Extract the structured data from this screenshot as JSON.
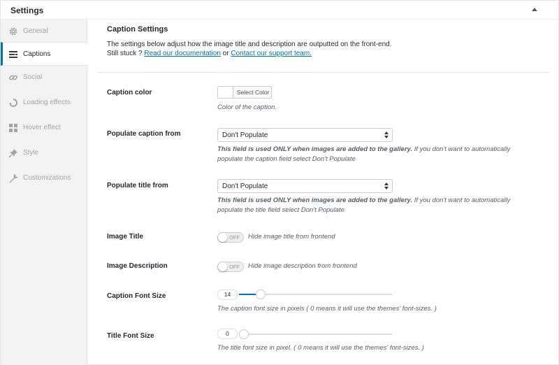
{
  "panel": {
    "title": "Settings"
  },
  "sidebar": {
    "items": [
      {
        "label": "General",
        "icon": "gear-icon",
        "active": false
      },
      {
        "label": "Captions",
        "icon": "caption-lines-icon",
        "active": true
      },
      {
        "label": "Social",
        "icon": "link-icon",
        "active": false
      },
      {
        "label": "Loading effects",
        "icon": "spinner-icon",
        "active": false
      },
      {
        "label": "Hover effect",
        "icon": "grid-icon",
        "active": false
      },
      {
        "label": "Style",
        "icon": "pin-icon",
        "active": false
      },
      {
        "label": "Customizations",
        "icon": "wrench-icon",
        "active": false
      }
    ]
  },
  "section": {
    "title": "Caption Settings",
    "desc_line1": "The settings below adjust how the image title and description are outputted on the front-end.",
    "desc_line2_prefix": "Still stuck ? ",
    "doc_link": "Read our documentation",
    "desc_or": " or ",
    "support_link": "Contact our support team."
  },
  "fields": {
    "caption_color": {
      "label": "Caption color",
      "button": "Select Color",
      "value": "#ffffff",
      "help": "Color of the caption."
    },
    "populate_caption": {
      "label": "Populate caption from",
      "value": "Don't Populate",
      "help_bold": "This field is used ONLY when images are added to the gallery.",
      "help_rest": " If you don't want to automatically populate the caption field select Don't Populate"
    },
    "populate_title": {
      "label": "Populate title from",
      "value": "Don't Populate",
      "help_bold": "This field is used ONLY when images are added to the gallery.",
      "help_rest": " If you don't want to automatically populate the title field select Don't Populate"
    },
    "image_title": {
      "label": "Image Title",
      "state": "OFF",
      "desc": "Hide image title from frontend"
    },
    "image_description": {
      "label": "Image Description",
      "state": "OFF",
      "desc": "Hide image description from frontend"
    },
    "caption_font_size": {
      "label": "Caption Font Size",
      "value": "14",
      "fraction": 0.14,
      "help": "The caption font size in pixels ( 0 means it will use the themes' font-sizes. )"
    },
    "title_font_size": {
      "label": "Title Font Size",
      "value": "0",
      "fraction": 0,
      "help": "The title font size in pixel. ( 0 means it will use the themes' font-sizes. )"
    }
  },
  "colors": {
    "accent": "#0073aa",
    "sidebar_bg": "#f3f3f3"
  }
}
